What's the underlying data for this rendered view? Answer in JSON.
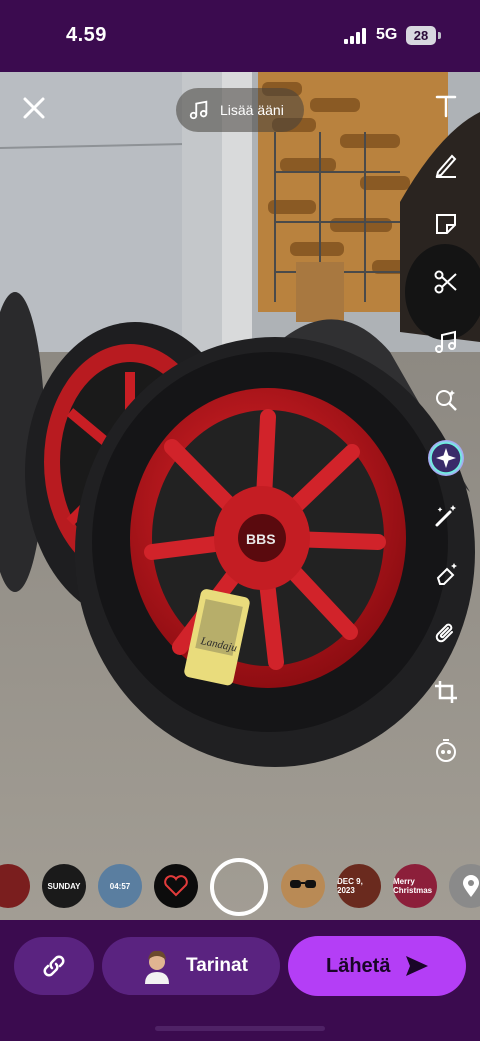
{
  "status_bar": {
    "time": "4.59",
    "network": "5G",
    "battery": "28"
  },
  "sound": {
    "label": "Lisää ääni"
  },
  "photo": {
    "can_label": "Landaju",
    "logo": "BBS"
  },
  "lenses": [
    {
      "text": ""
    },
    {
      "text": "SUNDAY"
    },
    {
      "text": "04:57"
    },
    {
      "text": ""
    },
    {
      "text": ""
    },
    {
      "text": "DEC 9, 2023"
    },
    {
      "text": "Merry Christmas"
    },
    {
      "text": ""
    }
  ],
  "bottom": {
    "stories_label": "Tarinat",
    "send_label": "Lähetä"
  }
}
